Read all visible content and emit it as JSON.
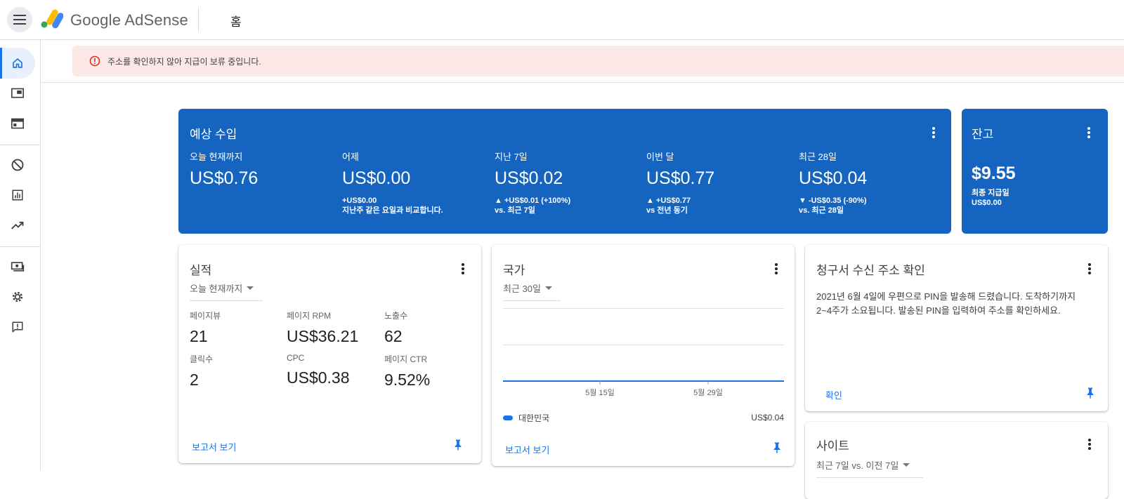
{
  "header": {
    "logo_text": "Google AdSense",
    "page_title": "홈"
  },
  "alert": {
    "message": "주소를 확인하지 않아 지급이 보류 중입니다."
  },
  "sidebar": {
    "items": [
      "home",
      "ads",
      "sites",
      "blocking-controls",
      "reports",
      "optimization",
      "payments",
      "settings",
      "feedback"
    ]
  },
  "estimated_earnings": {
    "title": "예상 수입",
    "metrics": [
      {
        "label": "오늘 현재까지",
        "value": "US$0.76",
        "sub1": "",
        "sub2": ""
      },
      {
        "label": "어제",
        "value": "US$0.00",
        "sub1": "+US$0.00",
        "sub2": "지난주 같은 요일과 비교합니다."
      },
      {
        "label": "지난 7일",
        "value": "US$0.02",
        "sub1": "▲ +US$0.01 (+100%)",
        "sub2": "vs. 최근 7일"
      },
      {
        "label": "이번 달",
        "value": "US$0.77",
        "sub1": "▲ +US$0.77",
        "sub2": "vs 전년 동기"
      },
      {
        "label": "최근 28일",
        "value": "US$0.04",
        "sub1": "▼ -US$0.35 (-90%)",
        "sub2": "vs. 최근 28일"
      }
    ]
  },
  "balance": {
    "title": "잔고",
    "value": "$9.55",
    "sub_label": "최종 지급일",
    "sub_value": "US$0.00"
  },
  "performance": {
    "title": "실적",
    "period": "오늘 현재까지",
    "stats": [
      {
        "label": "페이지뷰",
        "value": "21"
      },
      {
        "label": "페이지 RPM",
        "value": "US$36.21"
      },
      {
        "label": "노출수",
        "value": "62"
      },
      {
        "label": "클릭수",
        "value": "2"
      },
      {
        "label": "CPC",
        "value": "US$0.38"
      },
      {
        "label": "페이지 CTR",
        "value": "9.52%"
      }
    ],
    "link": "보고서 보기"
  },
  "countries": {
    "title": "국가",
    "period": "최근 30일",
    "link": "보고서 보기",
    "legend": {
      "name": "대한민국",
      "value": "US$0.04"
    },
    "chart_data": {
      "type": "line",
      "x_ticks": [
        "5월 15일",
        "5월 29일"
      ],
      "series": [
        {
          "name": "대한민국",
          "values": [
            0,
            0,
            0,
            0
          ]
        }
      ],
      "grid": true,
      "color": "#1a73e8"
    }
  },
  "billing_address": {
    "title": "청구서 수신 주소 확인",
    "body_line1": "2021년 6월 4일에 우편으로 PIN을 발송해 드렸습니다. 도착하기까지",
    "body_line2": "2~4주가 소요됩니다. 발송된 PIN을 입력하여 주소를 확인하세요.",
    "link": "확인"
  },
  "sites": {
    "title": "사이트",
    "period": "최근 7일 vs. 이전 7일"
  },
  "colors": {
    "primary_blue": "#1565c0",
    "link_blue": "#1a73e8",
    "alert_bg": "#fce8e6",
    "alert_icon": "#d93025"
  }
}
